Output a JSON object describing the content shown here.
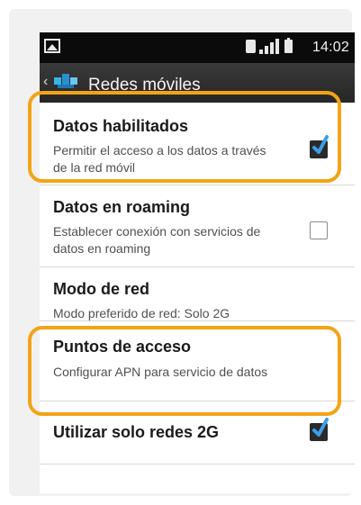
{
  "status_bar": {
    "time": "14:02",
    "icons": [
      "picture-icon",
      "sim-icon",
      "signal-icon",
      "battery-icon"
    ]
  },
  "action_bar": {
    "title": "Redes móviles",
    "back_icon": "‹",
    "app_icon": "network-settings-icon"
  },
  "settings": [
    {
      "title": "Datos habilitados",
      "summary": "Permitir el acceso a los datos a través de la red móvil",
      "checkbox": true,
      "checked": true,
      "highlighted": true
    },
    {
      "title": "Datos en roaming",
      "summary": "Establecer conexión con servicios de datos en roaming",
      "checkbox": true,
      "checked": false,
      "highlighted": false
    },
    {
      "title": "Modo de red",
      "summary": "Modo preferido de red: Solo 2G",
      "checkbox": false,
      "highlighted": false
    },
    {
      "title": "Puntos de acceso",
      "summary": "Configurar APN para servicio de datos",
      "checkbox": false,
      "highlighted": true
    },
    {
      "title": "Utilizar solo redes 2G",
      "summary": "",
      "checkbox": true,
      "checked": true,
      "highlighted": false
    }
  ],
  "colors": {
    "highlight": "#f3a416",
    "check_blue": "#3b9fe8",
    "status_bar": "#0b0b0b",
    "action_bar": "#2f2f2f"
  }
}
